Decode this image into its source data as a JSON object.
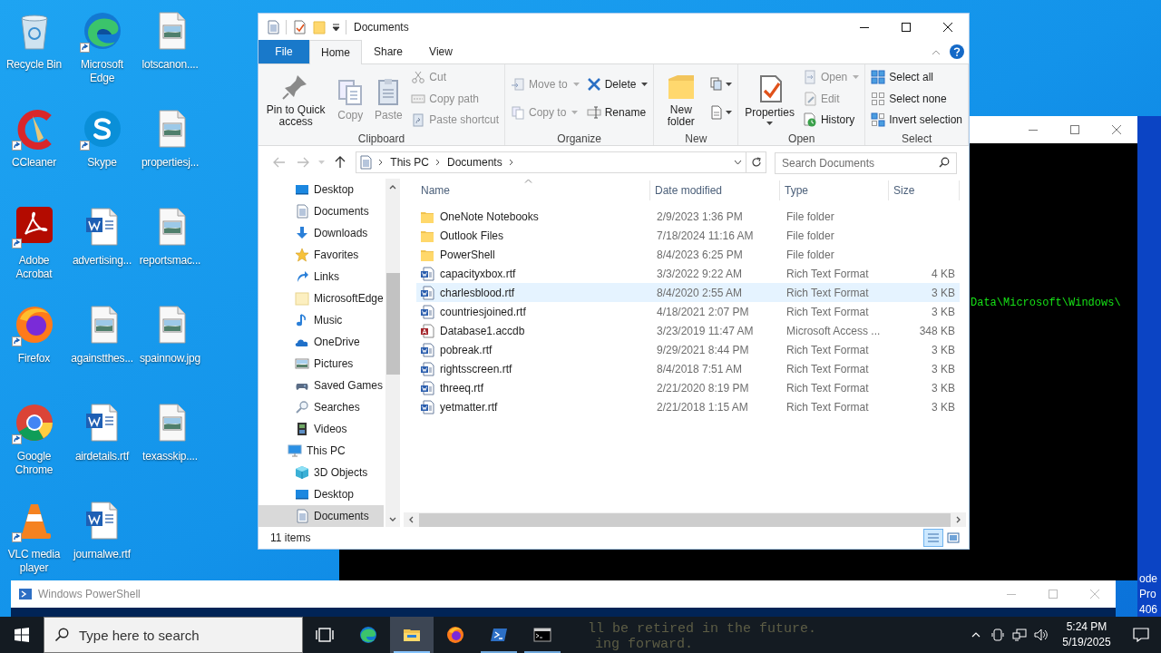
{
  "desktop_icons": [
    {
      "label": "Recycle Bin",
      "kind": "recycle",
      "shortcut": false
    },
    {
      "label": "CCleaner",
      "kind": "ccleaner",
      "shortcut": true
    },
    {
      "label": "Adobe Acrobat",
      "kind": "acrobat",
      "shortcut": true
    },
    {
      "label": "Firefox",
      "kind": "firefox",
      "shortcut": true
    },
    {
      "label": "Google Chrome",
      "kind": "chrome",
      "shortcut": true
    },
    {
      "label": "VLC media player",
      "kind": "vlc",
      "shortcut": true
    },
    {
      "label": "Microsoft Edge",
      "kind": "edge",
      "shortcut": true
    },
    {
      "label": "Skype",
      "kind": "skype",
      "shortcut": true
    },
    {
      "label": "advertising...",
      "kind": "word",
      "shortcut": false
    },
    {
      "label": "againstthes...",
      "kind": "image",
      "shortcut": false
    },
    {
      "label": "airdetails.rtf",
      "kind": "word",
      "shortcut": false
    },
    {
      "label": "journalwe.rtf",
      "kind": "word",
      "shortcut": false
    },
    {
      "label": "lotscanon....",
      "kind": "image",
      "shortcut": false
    },
    {
      "label": "propertiesj...",
      "kind": "image",
      "shortcut": false
    },
    {
      "label": "reportsmac...",
      "kind": "image",
      "shortcut": false
    },
    {
      "label": "spainnow.jpg",
      "kind": "image",
      "shortcut": false
    },
    {
      "label": "texasskip....",
      "kind": "image",
      "shortcut": false
    }
  ],
  "desktop_text": [
    "ode",
    "Pro",
    "406"
  ],
  "console": {
    "line": "Data\\Microsoft\\Windows\\"
  },
  "powershell": {
    "title": "Windows PowerShell",
    "lines": [
      "ll be retired in the future.",
      "ing forward."
    ]
  },
  "explorer": {
    "title": "Documents",
    "ribbon_tabs": [
      {
        "label": "File",
        "kind": "file",
        "selected": false
      },
      {
        "label": "Home",
        "kind": "tab",
        "selected": true
      },
      {
        "label": "Share",
        "kind": "tab",
        "selected": false
      },
      {
        "label": "View",
        "kind": "tab",
        "selected": false
      }
    ],
    "ribbon_groups": [
      {
        "label": "Clipboard",
        "columns": [
          [
            {
              "label": "Pin to Quick access",
              "kind": "large",
              "disabled": false,
              "has_menu": false
            }
          ],
          [
            {
              "label": "Copy",
              "kind": "large",
              "disabled": true,
              "has_menu": false
            }
          ],
          [
            {
              "label": "Paste",
              "kind": "large",
              "disabled": true,
              "has_menu": false
            }
          ],
          [
            {
              "label": "Cut",
              "kind": "small",
              "disabled": true,
              "has_menu": false
            },
            {
              "label": "Copy path",
              "kind": "small",
              "disabled": true,
              "has_menu": false
            },
            {
              "label": "Paste shortcut",
              "kind": "small",
              "disabled": true,
              "has_menu": false
            }
          ]
        ]
      },
      {
        "label": "Organize",
        "columns": [
          [
            {
              "label": "Move to",
              "kind": "small",
              "disabled": true,
              "has_menu": true
            },
            {
              "label": "Copy to",
              "kind": "small",
              "disabled": true,
              "has_menu": true
            }
          ],
          [
            {
              "label": "Delete",
              "kind": "small",
              "disabled": false,
              "has_menu": true
            },
            {
              "label": "Rename",
              "kind": "small",
              "disabled": false,
              "has_menu": false
            }
          ]
        ]
      },
      {
        "label": "New",
        "columns": [
          [
            {
              "label": "New folder",
              "kind": "large",
              "disabled": false,
              "has_menu": false
            }
          ],
          [
            {
              "kind": "icon",
              "disabled": false,
              "has_menu": true
            },
            {
              "kind": "icon",
              "disabled": false,
              "has_menu": true
            }
          ]
        ]
      },
      {
        "label": "Open",
        "columns": [
          [
            {
              "label": "Properties",
              "kind": "large",
              "disabled": false,
              "has_menu": true
            }
          ],
          [
            {
              "label": "Open",
              "kind": "small",
              "disabled": true,
              "has_menu": true
            },
            {
              "label": "Edit",
              "kind": "small",
              "disabled": true,
              "has_menu": false
            },
            {
              "label": "History",
              "kind": "small",
              "disabled": false,
              "has_menu": false
            }
          ]
        ]
      },
      {
        "label": "Select",
        "columns": [
          [
            {
              "label": "Select all",
              "kind": "small",
              "disabled": false,
              "has_menu": false
            },
            {
              "label": "Select none",
              "kind": "small",
              "disabled": false,
              "has_menu": false
            },
            {
              "label": "Invert selection",
              "kind": "small",
              "disabled": false,
              "has_menu": false
            }
          ]
        ]
      }
    ],
    "breadcrumb": [
      "This PC",
      "Documents"
    ],
    "search": {
      "placeholder": "Search Documents"
    },
    "quick_access_items": [
      {
        "label": "Desktop",
        "kind": "desktop",
        "selected": false
      },
      {
        "label": "Documents",
        "kind": "documents",
        "selected": false
      },
      {
        "label": "Downloads",
        "kind": "downloads",
        "selected": false
      },
      {
        "label": "Favorites",
        "kind": "favorites",
        "selected": false
      },
      {
        "label": "Links",
        "kind": "links",
        "selected": false
      },
      {
        "label": "MicrosoftEdge",
        "kind": "folder",
        "selected": false
      },
      {
        "label": "Music",
        "kind": "music",
        "selected": false
      },
      {
        "label": "OneDrive",
        "kind": "onedrive",
        "selected": false
      },
      {
        "label": "Pictures",
        "kind": "pictures",
        "selected": false
      },
      {
        "label": "Saved Games",
        "kind": "games",
        "selected": false
      },
      {
        "label": "Searches",
        "kind": "searches",
        "selected": false
      },
      {
        "label": "Videos",
        "kind": "videos",
        "selected": false
      }
    ],
    "tree": [
      {
        "label": "This PC",
        "kind": "pc",
        "selected": false,
        "children": [
          {
            "label": "3D Objects",
            "kind": "objects",
            "selected": false
          },
          {
            "label": "Desktop",
            "kind": "desktop",
            "selected": false
          },
          {
            "label": "Documents",
            "kind": "documents",
            "selected": true
          }
        ]
      }
    ],
    "columns": [
      "Name",
      "Date modified",
      "Type",
      "Size"
    ],
    "files": [
      {
        "name": "OneNote Notebooks",
        "date": "2/9/2023 1:36 PM",
        "type": "File folder",
        "kind": "folder",
        "selected": false
      },
      {
        "name": "Outlook Files",
        "date": "7/18/2024 11:16 AM",
        "type": "File folder",
        "kind": "folder",
        "selected": false
      },
      {
        "name": "PowerShell",
        "date": "8/4/2023 6:25 PM",
        "type": "File folder",
        "kind": "folder",
        "selected": false
      },
      {
        "name": "capacityxbox.rtf",
        "date": "3/3/2022 9:22 AM",
        "type": "Rich Text Format",
        "size": "4 KB",
        "kind": "word",
        "selected": false
      },
      {
        "name": "charlesblood.rtf",
        "date": "8/4/2020 2:55 AM",
        "type": "Rich Text Format",
        "size": "3 KB",
        "kind": "word",
        "selected": true
      },
      {
        "name": "countriesjoined.rtf",
        "date": "4/18/2021 2:07 PM",
        "type": "Rich Text Format",
        "size": "3 KB",
        "kind": "word",
        "selected": false
      },
      {
        "name": "Database1.accdb",
        "date": "3/23/2019 11:47 AM",
        "type": "Microsoft Access ...",
        "size": "348 KB",
        "kind": "access",
        "selected": false
      },
      {
        "name": "pobreak.rtf",
        "date": "9/29/2021 8:44 PM",
        "type": "Rich Text Format",
        "size": "3 KB",
        "kind": "word",
        "selected": false
      },
      {
        "name": "rightsscreen.rtf",
        "date": "8/4/2018 7:51 AM",
        "type": "Rich Text Format",
        "size": "3 KB",
        "kind": "word",
        "selected": false
      },
      {
        "name": "threeq.rtf",
        "date": "2/21/2020 8:19 PM",
        "type": "Rich Text Format",
        "size": "3 KB",
        "kind": "word",
        "selected": false
      },
      {
        "name": "yetmatter.rtf",
        "date": "2/21/2018 1:15 AM",
        "type": "Rich Text Format",
        "size": "3 KB",
        "kind": "word",
        "selected": false
      }
    ],
    "status": "11 items"
  },
  "taskbar": {
    "search_placeholder": "Type here to search",
    "apps": [
      {
        "kind": "taskview",
        "running": false,
        "active": false
      },
      {
        "kind": "edge",
        "running": false,
        "active": false
      },
      {
        "kind": "explorer",
        "running": true,
        "active": true
      },
      {
        "kind": "firefox",
        "running": false,
        "active": false
      },
      {
        "kind": "powershell",
        "running": true,
        "active": false
      },
      {
        "kind": "cmd",
        "running": true,
        "active": false
      }
    ],
    "time": "5:24 PM",
    "date": "5/19/2025"
  }
}
